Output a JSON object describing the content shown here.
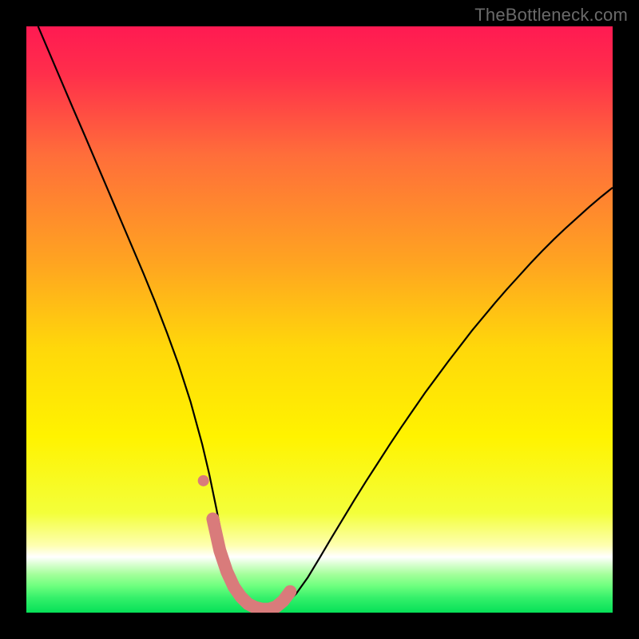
{
  "watermark": "TheBottleneck.com",
  "chart_data": {
    "type": "line",
    "title": "",
    "xlabel": "",
    "ylabel": "",
    "xlim": [
      0,
      1
    ],
    "ylim": [
      0,
      1
    ],
    "background_gradient": {
      "stops": [
        {
          "offset": 0.0,
          "color": "#ff1a52"
        },
        {
          "offset": 0.08,
          "color": "#ff2e4b"
        },
        {
          "offset": 0.22,
          "color": "#ff6e3a"
        },
        {
          "offset": 0.4,
          "color": "#ffa321"
        },
        {
          "offset": 0.55,
          "color": "#ffd80a"
        },
        {
          "offset": 0.7,
          "color": "#fff300"
        },
        {
          "offset": 0.83,
          "color": "#f3ff3a"
        },
        {
          "offset": 0.885,
          "color": "#feffb0"
        },
        {
          "offset": 0.905,
          "color": "#ffffff"
        },
        {
          "offset": 0.918,
          "color": "#d8ffd0"
        },
        {
          "offset": 0.935,
          "color": "#a3ff9a"
        },
        {
          "offset": 0.955,
          "color": "#6cff7e"
        },
        {
          "offset": 0.975,
          "color": "#34f06a"
        },
        {
          "offset": 1.0,
          "color": "#06e058"
        }
      ]
    },
    "series": [
      {
        "name": "bottleneck-curve",
        "color": "#000000",
        "stroke_width": 2.2,
        "x": [
          0.02,
          0.04,
          0.06,
          0.08,
          0.1,
          0.12,
          0.14,
          0.16,
          0.18,
          0.2,
          0.22,
          0.24,
          0.26,
          0.28,
          0.3,
          0.312,
          0.324,
          0.336,
          0.348,
          0.36,
          0.372,
          0.384,
          0.396,
          0.408,
          0.42,
          0.44,
          0.46,
          0.48,
          0.5,
          0.52,
          0.54,
          0.56,
          0.58,
          0.6,
          0.62,
          0.64,
          0.66,
          0.68,
          0.7,
          0.72,
          0.74,
          0.76,
          0.78,
          0.8,
          0.82,
          0.84,
          0.86,
          0.88,
          0.9,
          0.92,
          0.94,
          0.96,
          0.98,
          1.0
        ],
        "y": [
          1.0,
          0.953,
          0.906,
          0.859,
          0.813,
          0.766,
          0.719,
          0.672,
          0.625,
          0.578,
          0.529,
          0.477,
          0.422,
          0.36,
          0.287,
          0.236,
          0.178,
          0.117,
          0.072,
          0.044,
          0.025,
          0.013,
          0.007,
          0.004,
          0.005,
          0.013,
          0.032,
          0.06,
          0.093,
          0.127,
          0.16,
          0.193,
          0.225,
          0.256,
          0.287,
          0.317,
          0.346,
          0.375,
          0.402,
          0.429,
          0.455,
          0.481,
          0.505,
          0.529,
          0.552,
          0.574,
          0.596,
          0.617,
          0.637,
          0.656,
          0.674,
          0.692,
          0.709,
          0.725
        ]
      },
      {
        "name": "highlight-band",
        "color": "#d97b7b",
        "stroke_width": 16,
        "linecap": "round",
        "x": [
          0.318,
          0.33,
          0.342,
          0.354,
          0.366,
          0.378,
          0.39,
          0.402,
          0.414,
          0.426,
          0.438,
          0.45
        ],
        "y": [
          0.16,
          0.106,
          0.07,
          0.044,
          0.027,
          0.015,
          0.009,
          0.006,
          0.006,
          0.01,
          0.02,
          0.036
        ]
      }
    ],
    "points": [
      {
        "name": "marker-dot",
        "x": 0.302,
        "y": 0.225,
        "r": 7,
        "color": "#d97b7b"
      }
    ]
  }
}
